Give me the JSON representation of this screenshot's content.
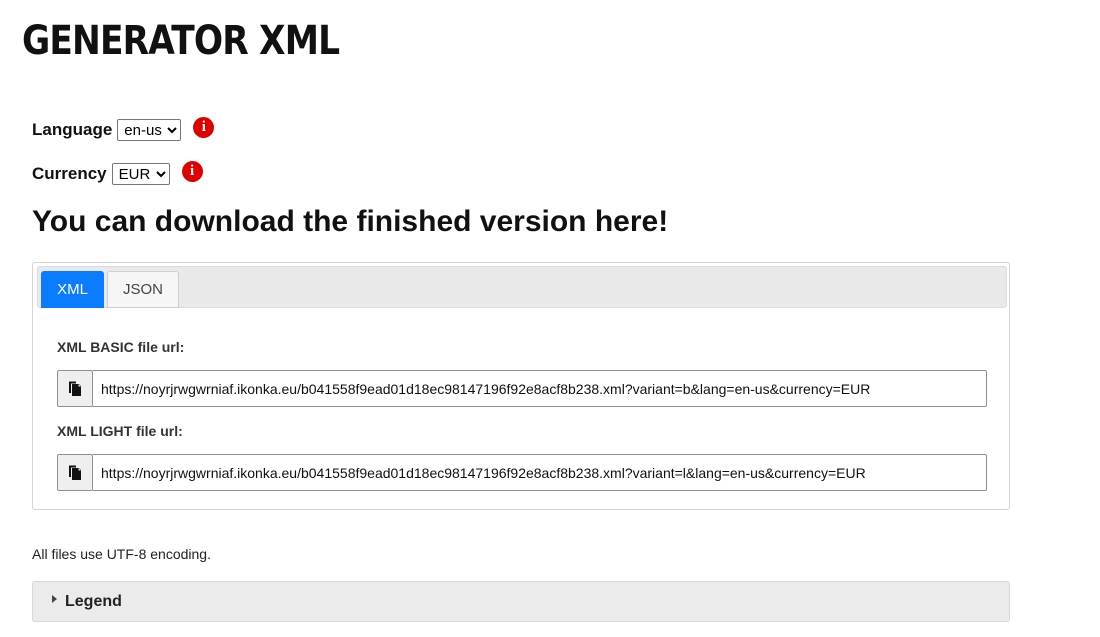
{
  "page": {
    "title": "GENERATOR XML"
  },
  "settings": {
    "language": {
      "label": "Language",
      "selected": "en-us",
      "info_icon": "info-circle-icon"
    },
    "currency": {
      "label": "Currency",
      "selected": "EUR",
      "info_icon": "info-circle-icon"
    },
    "info_icon_color": "#e00000"
  },
  "download": {
    "heading": "You can download the finished version here!",
    "tabs": [
      {
        "label": "XML",
        "active": true
      },
      {
        "label": "JSON",
        "active": false
      }
    ],
    "accent_color": "#0a7cff",
    "fields": [
      {
        "label": "XML BASIC file url:",
        "value": "https://noyrjrwgwrniaf.ikonka.eu/b041558f9ead01d18ec98147196f92e8acf8b238.xml?variant=b&lang=en-us&currency=EUR",
        "copy_icon": "copy-icon"
      },
      {
        "label": "XML LIGHT file url:",
        "value": "https://noyrjrwgwrniaf.ikonka.eu/b041558f9ead01d18ec98147196f92e8acf8b238.xml?variant=l&lang=en-us&currency=EUR",
        "copy_icon": "copy-icon"
      }
    ]
  },
  "footer": {
    "encoding_note": "All files use UTF-8 encoding.",
    "legend_label": "Legend",
    "legend_icon": "caret-right-icon"
  }
}
